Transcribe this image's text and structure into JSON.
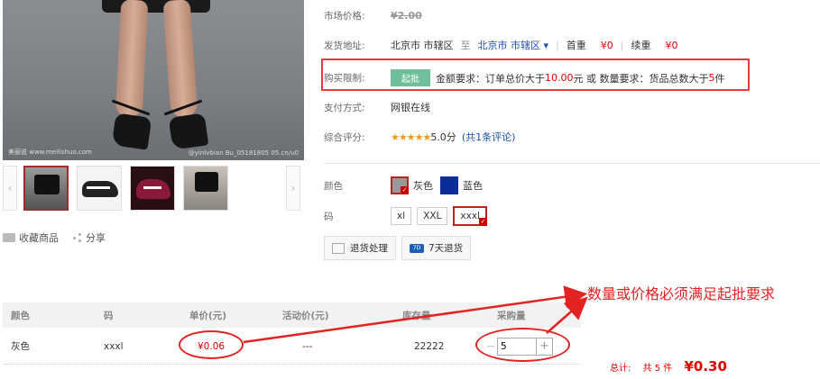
{
  "gallery": {
    "caption_left": "美丽说  www.meilishuo.com",
    "caption_right": "@yinlvbian  Bu_05181805  05.cn/u0"
  },
  "actions": {
    "favorite": "收藏商品",
    "share": "分享"
  },
  "product": {
    "market_price_label": "市场价格:",
    "market_price": "¥2.00",
    "ship_label": "发货地址:",
    "ship_from": "北京市 市辖区",
    "ship_to_sep": "至",
    "ship_to": "北京市 市辖区 ▾",
    "shipping_first_label": "首重",
    "shipping_first_value": "¥0",
    "shipping_cont_label": "续重",
    "shipping_cont_value": "¥0",
    "limit_label": "购买限制:",
    "limit_badge": "起批",
    "limit_text_1": "金额要求：订单总价大于",
    "limit_amount": "10.00",
    "limit_text_2": "元 或 数量要求：货品总数大于",
    "limit_qty": "5",
    "limit_text_3": "件",
    "pay_label": "支付方式:",
    "pay_value": "网银在线",
    "rating_label": "综合评分:",
    "rating_stars": "★★★★★",
    "rating_score": "5.0分",
    "rating_reviews": "(共1条评论)",
    "color_label": "颜色",
    "colors": [
      {
        "name": "灰色",
        "selected": true,
        "hex": "#999999"
      },
      {
        "name": "蓝色",
        "selected": false,
        "hex": "#0b2d9a"
      }
    ],
    "size_label": "码",
    "sizes": [
      {
        "name": "xl",
        "selected": false
      },
      {
        "name": "XXL",
        "selected": false
      },
      {
        "name": "xxxl",
        "selected": true
      }
    ],
    "services": [
      {
        "label": "退货处理",
        "icon": "box-icon"
      },
      {
        "label": "7天退货",
        "icon": "seven-day-icon"
      }
    ]
  },
  "table": {
    "headers": [
      "颜色",
      "码",
      "单价(元)",
      "活动价(元)",
      "库存量",
      "采购量"
    ],
    "rows": [
      {
        "color": "灰色",
        "size": "xxxl",
        "price": "¥0.06",
        "promo": "---",
        "stock": "22222",
        "qty": "5"
      }
    ]
  },
  "annotation": "数量或价格必须满足起批要求",
  "summary": {
    "total_label": "总计:",
    "count_text": "共 5 件",
    "amount": "¥0.30"
  },
  "accent": "#e32222"
}
